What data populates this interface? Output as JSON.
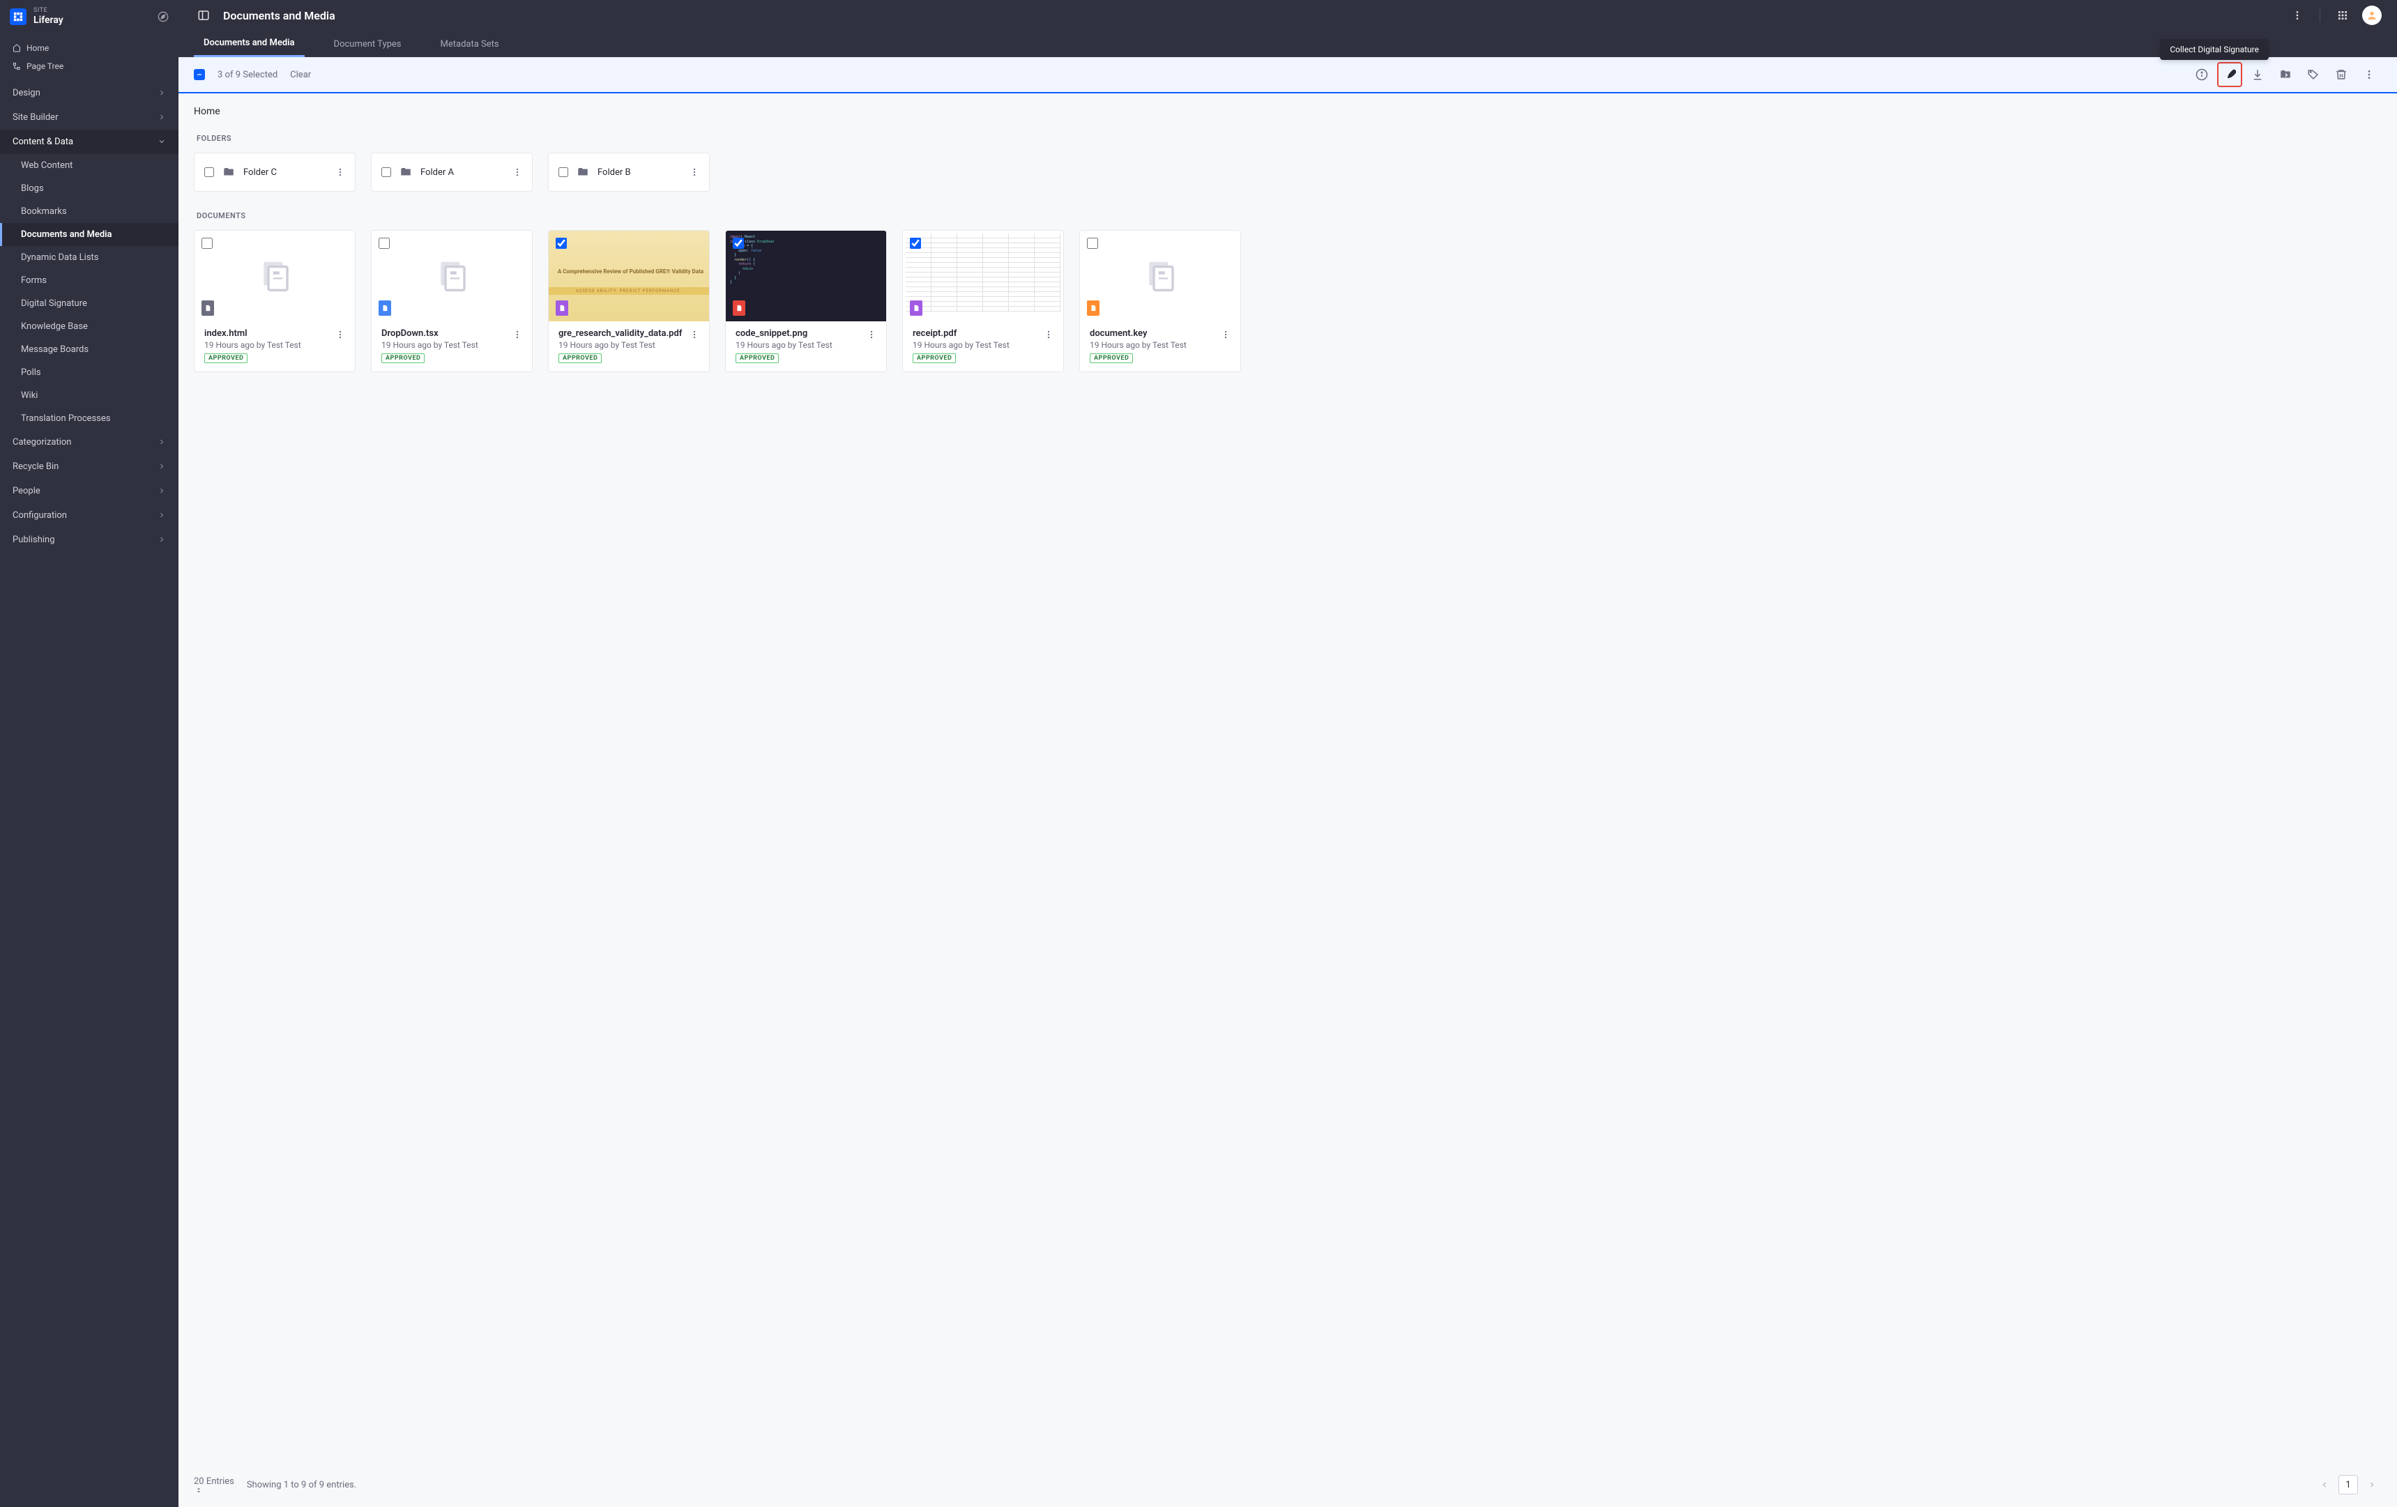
{
  "site": {
    "label": "SITE",
    "name": "Liferay"
  },
  "nav_top": {
    "home": "Home",
    "page_tree": "Page Tree"
  },
  "nav_sections": {
    "design": "Design",
    "site_builder": "Site Builder",
    "content_data": "Content & Data",
    "categorization": "Categorization",
    "recycle_bin": "Recycle Bin",
    "people": "People",
    "configuration": "Configuration",
    "publishing": "Publishing"
  },
  "nav_sub": {
    "web_content": "Web Content",
    "blogs": "Blogs",
    "bookmarks": "Bookmarks",
    "documents_media": "Documents and Media",
    "dynamic_data_lists": "Dynamic Data Lists",
    "forms": "Forms",
    "digital_signature": "Digital Signature",
    "knowledge_base": "Knowledge Base",
    "message_boards": "Message Boards",
    "polls": "Polls",
    "wiki": "Wiki",
    "translation_processes": "Translation Processes"
  },
  "topbar": {
    "title": "Documents and Media"
  },
  "tabs": {
    "documents_media": "Documents and Media",
    "document_types": "Document Types",
    "metadata_sets": "Metadata Sets"
  },
  "tooltip": {
    "collect_signature": "Collect Digital Signature"
  },
  "selection": {
    "count_text": "3 of 9 Selected",
    "clear": "Clear"
  },
  "breadcrumb": {
    "home": "Home"
  },
  "sections": {
    "folders": "FOLDERS",
    "documents": "DOCUMENTS"
  },
  "folders": [
    {
      "name": "Folder C"
    },
    {
      "name": "Folder A"
    },
    {
      "name": "Folder B"
    }
  ],
  "documents": [
    {
      "title": "index.html",
      "meta": "19 Hours ago by Test Test",
      "status": "APPROVED",
      "thumb": "placeholder",
      "badge": "generic",
      "checked": false
    },
    {
      "title": "DropDown.tsx",
      "meta": "19 Hours ago by Test Test",
      "status": "APPROVED",
      "thumb": "placeholder",
      "badge": "gdoc",
      "checked": false
    },
    {
      "title": "gre_research_validity_data.pdf",
      "meta": "19 Hours ago by Test Test",
      "status": "APPROVED",
      "thumb": "yellow",
      "badge": "pdf",
      "checked": true
    },
    {
      "title": "code_snippet.png",
      "meta": "19 Hours ago by Test Test",
      "status": "APPROVED",
      "thumb": "code",
      "badge": "img",
      "checked": true
    },
    {
      "title": "receipt.pdf",
      "meta": "19 Hours ago by Test Test",
      "status": "APPROVED",
      "thumb": "receipt",
      "badge": "pdf",
      "checked": true
    },
    {
      "title": "document.key",
      "meta": "19 Hours ago by Test Test",
      "status": "APPROVED",
      "thumb": "placeholder",
      "badge": "key",
      "checked": false
    }
  ],
  "thumb_content": {
    "yellow_title": "A Comprehensive Review of Published GRE® Validity Data",
    "yellow_bar": "ASSESS ABILITY. PREDICT PERFORMANCE."
  },
  "footer": {
    "entries": "20 Entries",
    "showing": "Showing 1 to 9 of 9 entries.",
    "page": "1"
  }
}
